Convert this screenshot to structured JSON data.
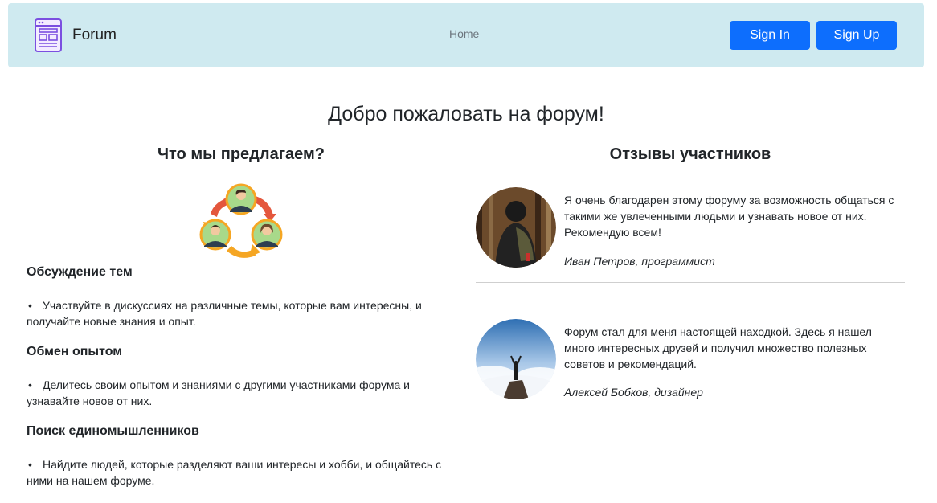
{
  "navbar": {
    "brand": "Forum",
    "brand_icon": "layout-window-icon",
    "home_label": "Home",
    "sign_in_label": "Sign In",
    "sign_up_label": "Sign Up"
  },
  "main": {
    "welcome_title": "Добро пожаловать на форум!",
    "offer": {
      "title": "Что мы предлагаем?",
      "image_icon": "community-cycle-icon",
      "items": [
        {
          "heading": "Обсуждение тем",
          "text": "Участвуйте в дискуссиях на различные темы, которые вам интересны, и получайте новые знания и опыт."
        },
        {
          "heading": "Обмен опытом",
          "text": "Делитесь своим опытом и знаниями с другими участниками форума и узнавайте новое от них."
        },
        {
          "heading": "Поиск единомышленников",
          "text": "Найдите людей, которые разделяют ваши интересы и хобби, и общайтесь с ними на нашем форуме."
        }
      ]
    },
    "reviews": {
      "title": "Отзывы участников",
      "items": [
        {
          "text": "Я очень благодарен этому форуму за возможность общаться с такими же увлеченными людьми и узнавать новое от них. Рекомендую всем!",
          "author": "Иван Петров, программист"
        },
        {
          "text": "Форум стал для меня настоящей находкой. Здесь я нашел много интересных друзей и получил множество полезных советов и рекомендаций.",
          "author": "Алексей Бобков, дизайнер"
        }
      ]
    }
  },
  "colors": {
    "navbar_bg": "#cfeaf0",
    "primary_button": "#0d6efd",
    "text": "#212529",
    "muted_link": "#6c757d"
  }
}
